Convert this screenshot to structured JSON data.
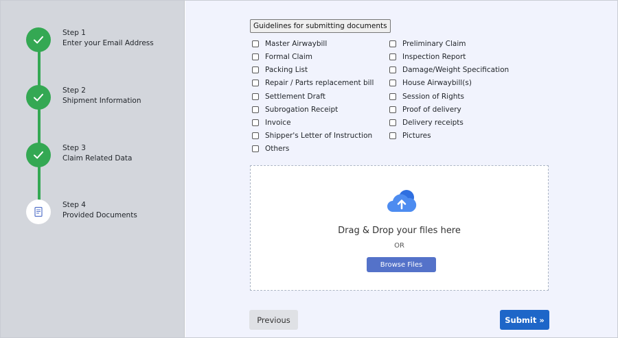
{
  "steps": [
    {
      "number": "Step 1",
      "title": "Enter your Email Address",
      "status": "done"
    },
    {
      "number": "Step 2",
      "title": "Shipment Information",
      "status": "done"
    },
    {
      "number": "Step 3",
      "title": "Claim Related Data",
      "status": "done"
    },
    {
      "number": "Step 4",
      "title": "Provided Documents",
      "status": "current"
    }
  ],
  "guidelines_label": "Guidelines for submitting documents",
  "documents_left": [
    "Master Airwaybill",
    "Formal Claim",
    "Packing List",
    "Repair / Parts replacement bill",
    "Settlement Draft",
    "Subrogation Receipt",
    "Invoice",
    "Shipper's Letter of Instruction",
    "Others"
  ],
  "documents_right": [
    "Preliminary Claim",
    "Inspection Report",
    "Damage/Weight Specification",
    "House Airwaybill(s)",
    "Session of Rights",
    "Proof of delivery",
    "Delivery receipts",
    "Pictures"
  ],
  "upload": {
    "drag_text": "Drag & Drop your files here",
    "or_text": "OR",
    "browse_label": "Browse Files"
  },
  "nav": {
    "previous_label": "Previous",
    "submit_label": "Submit »"
  },
  "colors": {
    "step_done": "#34a853",
    "primary": "#1e66c8",
    "browse": "#5472c9"
  }
}
